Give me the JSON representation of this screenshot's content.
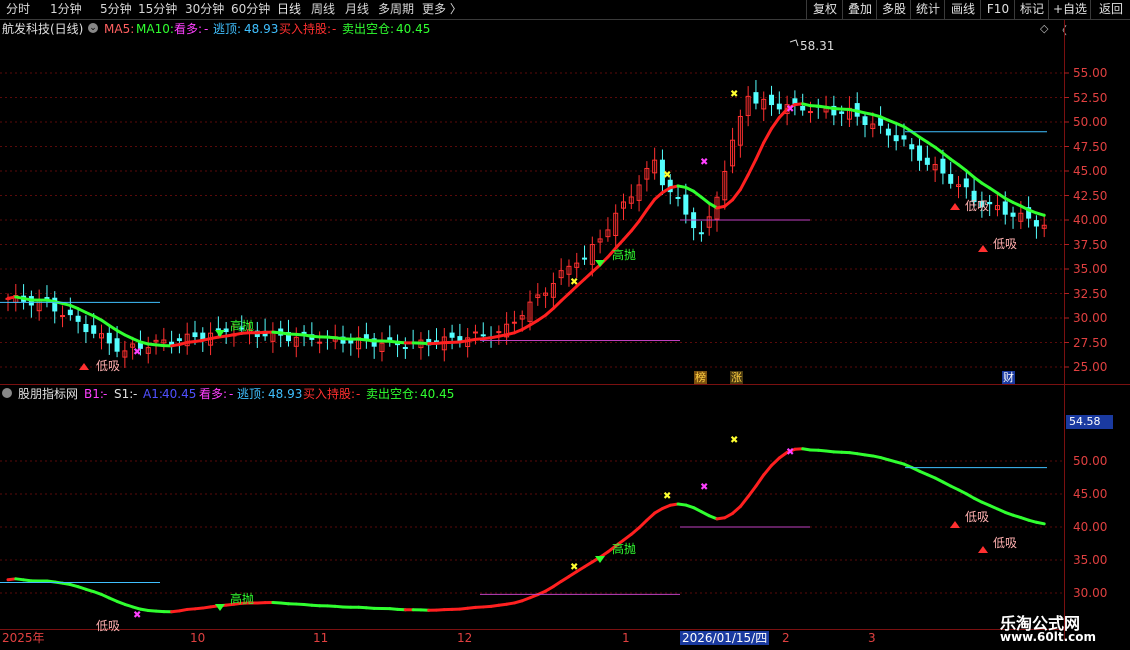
{
  "toolbar": {
    "periods": [
      "分时",
      "1分钟",
      "5分钟",
      "15分钟",
      "30分钟",
      "60分钟",
      "日线",
      "周线",
      "月线",
      "多周期",
      "更多 〉"
    ],
    "active_period": "日线",
    "right_buttons": [
      "复权",
      "叠加",
      "多股",
      "统计",
      "画线",
      "F10",
      "标记",
      "+自选",
      "返回"
    ]
  },
  "main_panel": {
    "stock": "航发科技(日线)",
    "ma5_label": "MA5:",
    "ma10_label": "MA10:",
    "kanduo_label": "看多:",
    "kanduo_value": "-",
    "taoding_label": "逃顶:",
    "taoding_value": "48.93",
    "buy_label": "买入持股:",
    "buy_value": "-",
    "sell_label": "卖出空仓:",
    "sell_value": "40.45",
    "peak_label": "58.31",
    "y_ticks": [
      "55.00",
      "52.50",
      "50.00",
      "47.50",
      "45.00",
      "42.50",
      "40.00",
      "37.50",
      "35.00",
      "32.50",
      "30.00",
      "27.50",
      "25.00"
    ],
    "annotations": {
      "gaopao": "高抛",
      "dixi": "低吸",
      "bang": "榜",
      "zhang": "涨",
      "cai": "财"
    }
  },
  "sub_panel": {
    "title": "股朋指标网",
    "b1_label": "B1:",
    "b1_value": "-",
    "s1_label": "S1:",
    "s1_value": "-",
    "a1_label": "A1:",
    "a1_value": "40.45",
    "kanduo_label": "看多:",
    "kanduo_value": "-",
    "taoding_label": "逃顶:",
    "taoding_value": "48.93",
    "buy_label": "买入持股:",
    "buy_value": "-",
    "sell_label": "卖出空仓:",
    "sell_value": "40.45",
    "current_value": "54.58",
    "y_ticks": [
      "50.00",
      "45.00",
      "40.00",
      "35.00",
      "30.00"
    ]
  },
  "x_axis": {
    "labels": [
      "2025年",
      "10",
      "11",
      "12",
      "1",
      "2026/01/15/四",
      "2",
      "3"
    ]
  },
  "watermark": {
    "line1": "乐淘公式网",
    "line2": "www.60lt.com"
  },
  "colors": {
    "up": "#ff3030",
    "down": "#54ffff",
    "ma_up": "#ff2020",
    "ma_down": "#30ff30",
    "grid": "#7a1010"
  }
}
